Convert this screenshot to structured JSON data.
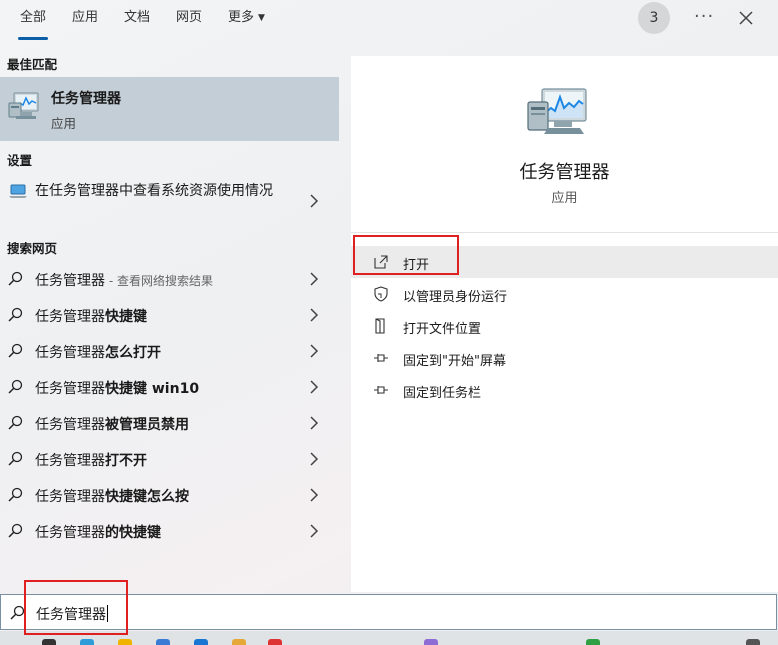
{
  "tabs": [
    {
      "label": "全部",
      "active": true
    },
    {
      "label": "应用"
    },
    {
      "label": "文档"
    },
    {
      "label": "网页"
    },
    {
      "label": "更多"
    }
  ],
  "header": {
    "badge_count": "3"
  },
  "best_match": {
    "section": "最佳匹配",
    "title": "任务管理器",
    "subtitle": "应用"
  },
  "settings": {
    "section": "设置",
    "item": "在任务管理器中查看系统资源使用情况"
  },
  "web": {
    "section": "搜索网页",
    "items": [
      {
        "base": "任务管理器",
        "suffix": "",
        "hint": " - 查看网络搜索结果"
      },
      {
        "base": "任务管理器",
        "suffix": "快捷键",
        "hint": ""
      },
      {
        "base": "任务管理器",
        "suffix": "怎么打开",
        "hint": ""
      },
      {
        "base": "任务管理器",
        "suffix": "快捷键 win10",
        "hint": ""
      },
      {
        "base": "任务管理器",
        "suffix": "被管理员禁用",
        "hint": ""
      },
      {
        "base": "任务管理器",
        "suffix": "打不开",
        "hint": ""
      },
      {
        "base": "任务管理器",
        "suffix": "快捷键怎么按",
        "hint": ""
      },
      {
        "base": "任务管理器",
        "suffix": "的快捷键",
        "hint": ""
      }
    ]
  },
  "detail": {
    "title": "任务管理器",
    "subtitle": "应用",
    "actions": [
      {
        "label": "打开",
        "icon": "open-icon"
      },
      {
        "label": "以管理员身份运行",
        "icon": "shield-icon"
      },
      {
        "label": "打开文件位置",
        "icon": "file-location-icon"
      },
      {
        "label": "固定到\"开始\"屏幕",
        "icon": "pin-icon"
      },
      {
        "label": "固定到任务栏",
        "icon": "pin-icon"
      }
    ]
  },
  "search": {
    "value": "任务管理器"
  },
  "colors": {
    "accent": "#0a5ea8",
    "highlight_box": "#e02020",
    "selected_bg": "#c4ced6"
  }
}
